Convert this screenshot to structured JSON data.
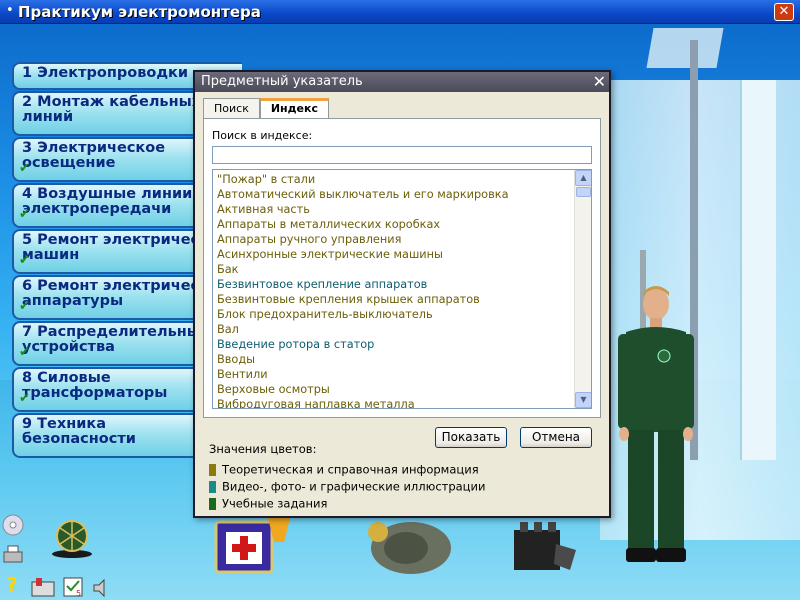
{
  "app": {
    "title": "Практикум электромонтера"
  },
  "menu": {
    "items": [
      {
        "num": "1",
        "label": "Электропроводки",
        "checked": false
      },
      {
        "num": "2",
        "label": "Монтаж кабельных\nлиний",
        "checked": false
      },
      {
        "num": "3",
        "label": "Электрическое\nосвещение",
        "checked": true
      },
      {
        "num": "4",
        "label": "Воздушные линии\nэлектропередачи",
        "checked": true
      },
      {
        "num": "5",
        "label": "Ремонт электричес\nмашин",
        "checked": true
      },
      {
        "num": "6",
        "label": "Ремонт электричес\nаппаратуры",
        "checked": true
      },
      {
        "num": "7",
        "label": "Распределительные\nустройства",
        "checked": true
      },
      {
        "num": "8",
        "label": "Силовые\nтрансформаторы",
        "checked": true
      },
      {
        "num": "9",
        "label": "Техника\nбезопасности",
        "checked": false
      }
    ]
  },
  "dialog": {
    "title": "Предметный указатель",
    "tabs": [
      {
        "label": "Поиск",
        "active": false
      },
      {
        "label": "Индекс",
        "active": true
      }
    ],
    "search_label": "Поиск в индексе:",
    "search_value": "",
    "items": [
      {
        "text": "\"Пожар\" в стали",
        "cat": "theory"
      },
      {
        "text": "Автоматический выключатель и его маркировка",
        "cat": "theory"
      },
      {
        "text": "Активная часть",
        "cat": "theory"
      },
      {
        "text": "Аппараты в металлических коробках",
        "cat": "theory"
      },
      {
        "text": "Аппараты ручного управления",
        "cat": "theory"
      },
      {
        "text": "Асинхронные электрические машины",
        "cat": "theory"
      },
      {
        "text": "Бак",
        "cat": "theory"
      },
      {
        "text": "Безвинтовое крепление аппаратов",
        "cat": "video"
      },
      {
        "text": "Безвинтовые крепления крышек аппаратов",
        "cat": "theory"
      },
      {
        "text": "Блок предохранитель-выключатель",
        "cat": "theory"
      },
      {
        "text": "Вал",
        "cat": "theory"
      },
      {
        "text": "Введение ротора в статор",
        "cat": "video"
      },
      {
        "text": "Вводы",
        "cat": "theory"
      },
      {
        "text": "Вентили",
        "cat": "theory"
      },
      {
        "text": "Верховые осмотры",
        "cat": "theory"
      },
      {
        "text": "Вибродуговая наплавка металла",
        "cat": "theory"
      }
    ],
    "buttons": {
      "show": "Показать",
      "cancel": "Отмена"
    },
    "legend": {
      "title": "Значения цветов:",
      "entries": [
        {
          "text": "Теоретическая и справочная информация",
          "color": "#8a7a10"
        },
        {
          "text": "Видео-, фото- и графические иллюстрации",
          "color": "#1a8a8a"
        },
        {
          "text": "Учебные задания",
          "color": "#1a6a1a"
        }
      ]
    }
  },
  "colors": {
    "theory": "#6b5f0a",
    "video": "#0f5c6e",
    "task": "#1a6a1a"
  }
}
